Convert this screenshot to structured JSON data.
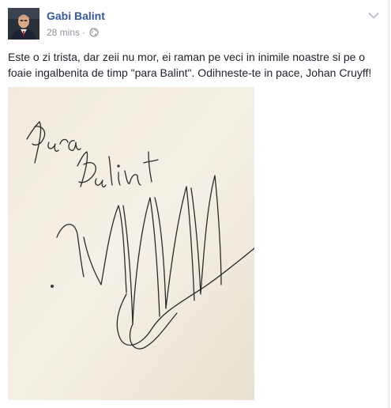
{
  "post": {
    "author_name": "Gabi Balint",
    "timestamp": "28 mins",
    "separator": "·",
    "audience_icon": "globe-icon",
    "options_icon": "chevron-down-icon",
    "avatar_icon": "profile-photo",
    "message": "Este o zi trista, dar zeii nu mor, ei raman pe veci in inimile noastre si pe o foaie ingalbenita de timp \"para Balint\". Odihneste-te in pace, Johan Cruyff!",
    "photo": {
      "handwriting": "Para Balint",
      "lettering_note_type": "handwritten-signature"
    }
  },
  "colors": {
    "author_link": "#365899",
    "meta_text": "#90949c",
    "body_text": "#1d2129",
    "paper": "#f3eee3"
  }
}
